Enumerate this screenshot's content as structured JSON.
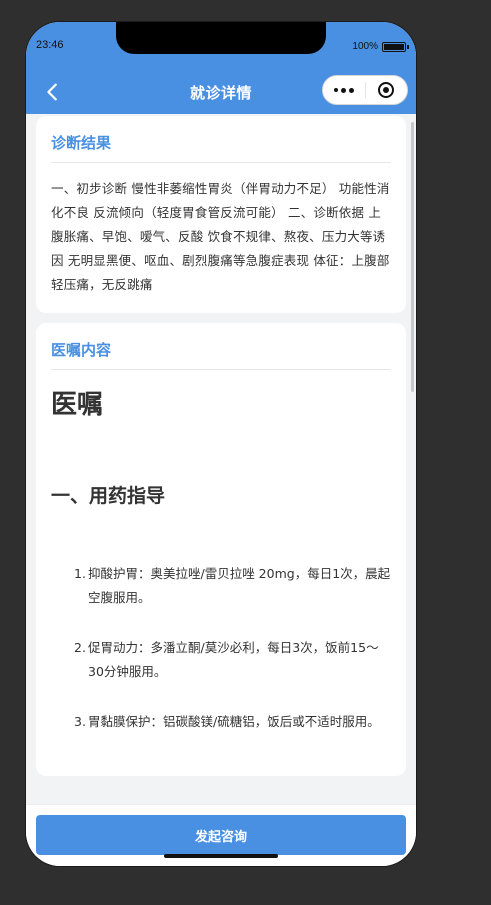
{
  "status": {
    "time": "23:46",
    "battery": "100%"
  },
  "navbar": {
    "title": "就诊详情"
  },
  "diagnosis": {
    "title": "诊断结果",
    "text": "一、初步诊断 慢性非萎缩性胃炎（伴胃动力不足） 功能性消化不良 反流倾向（轻度胃食管反流可能） 二、诊断依据 上腹胀痛、早饱、嗳气、反酸 饮食不规律、熬夜、压力大等诱因 无明显黑便、呕血、剧烈腹痛等急腹症表现 体征：上腹部轻压痛，无反跳痛"
  },
  "advice": {
    "title": "医嘱内容",
    "h1": "医嘱",
    "h2": "一、用药指导",
    "items": [
      {
        "num": "1.",
        "text": "抑酸护胃：奥美拉唑/雷贝拉唑 20mg，每日1次，晨起空腹服用。"
      },
      {
        "num": "2.",
        "text": "促胃动力：多潘立酮/莫沙必利，每日3次，饭前15～30分钟服用。"
      },
      {
        "num": "3.",
        "text": "胃黏膜保护：铝碳酸镁/硫糖铝，饭后或不适时服用。"
      }
    ]
  },
  "bottom": {
    "button_label": "发起咨询"
  },
  "colors": {
    "accent": "#4a90e2",
    "page_bg": "#f2f3f5",
    "outer_bg": "#2f2f2f"
  },
  "icons": {
    "back": "chevron-left-icon",
    "more": "more-dots-icon",
    "close": "target-icon"
  }
}
